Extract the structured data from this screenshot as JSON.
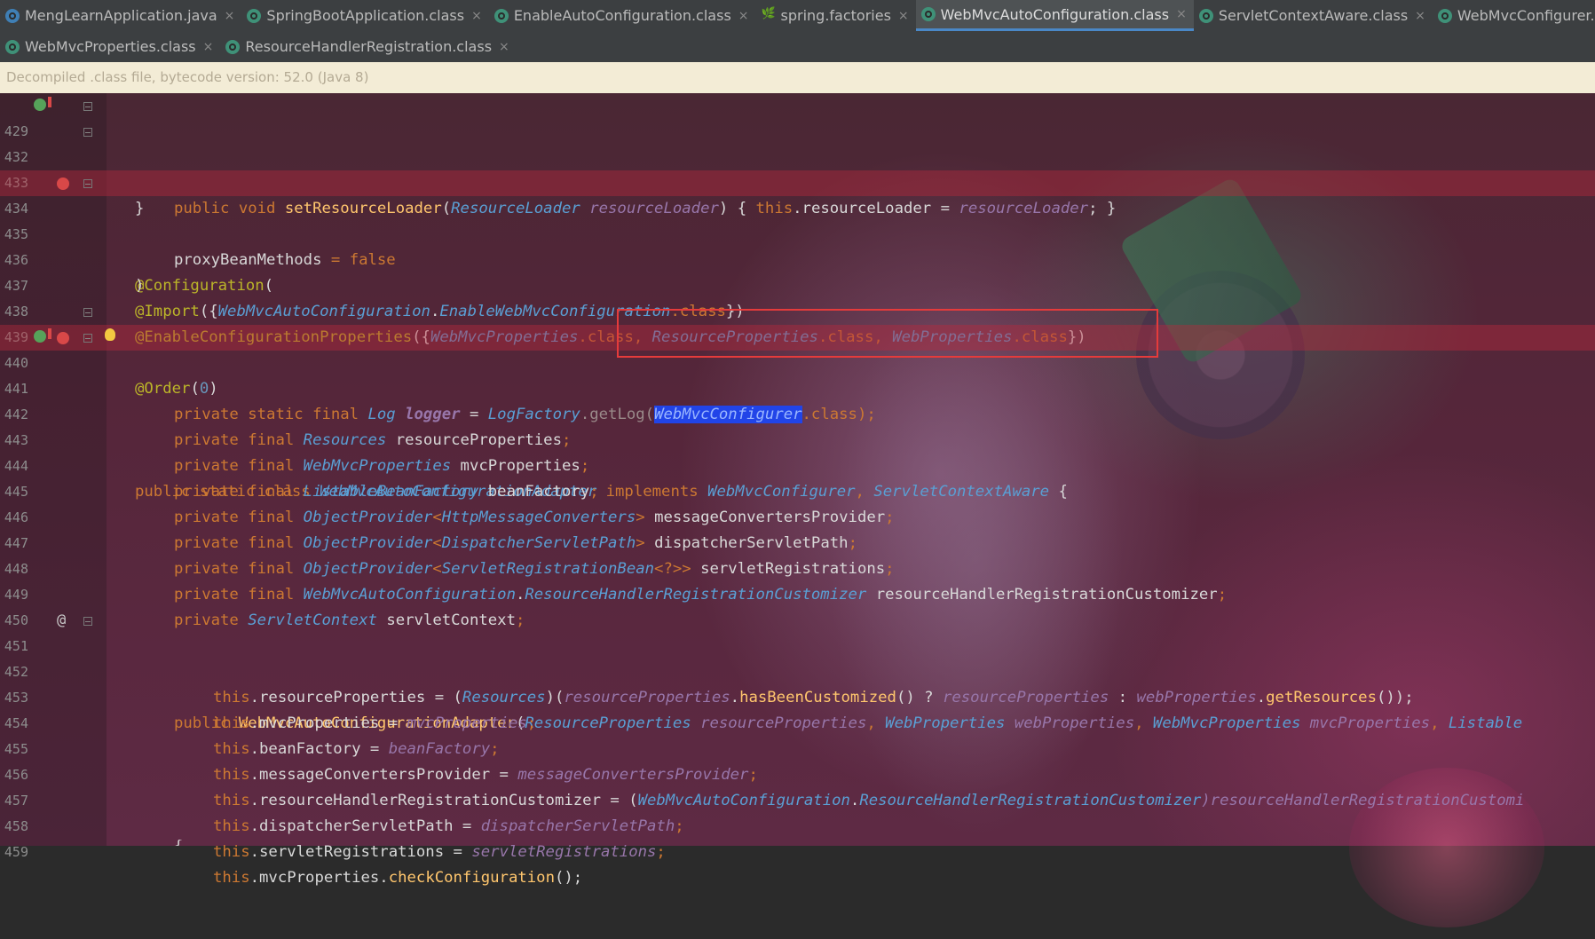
{
  "tabs_row1": [
    {
      "label": "MengLearnApplication.java",
      "icon": "java-class-icon",
      "active": false
    },
    {
      "label": "SpringBootApplication.class",
      "icon": "annotation-icon",
      "active": false
    },
    {
      "label": "EnableAutoConfiguration.class",
      "icon": "annotation-icon",
      "active": false
    },
    {
      "label": "spring.factories",
      "icon": "spring-leaf-icon",
      "active": false
    },
    {
      "label": "WebMvcAutoConfiguration.class",
      "icon": "class-icon",
      "active": true
    },
    {
      "label": "ServletContextAware.class",
      "icon": "interface-icon",
      "active": false
    },
    {
      "label": "WebMvcConfigurer.class",
      "icon": "interface-icon",
      "active": false
    }
  ],
  "tabs_row2": [
    {
      "label": "WebMvcProperties.class",
      "icon": "class-icon",
      "active": false
    },
    {
      "label": "ResourceHandlerRegistration.class",
      "icon": "class-icon",
      "active": false
    }
  ],
  "tab_close_glyph": "×",
  "notice": "Decompiled .class file, bytecode version: 52.0 (Java 8)",
  "gutter": {
    "at_symbol": "@",
    "line_numbers": [
      "429",
      "432",
      "433",
      "434",
      "435",
      "436",
      "437",
      "438",
      "439",
      "440",
      "441",
      "442",
      "443",
      "444",
      "445",
      "446",
      "447",
      "448",
      "449",
      "450",
      "451",
      "452",
      "453",
      "454",
      "455",
      "456",
      "457",
      "458",
      "459"
    ]
  },
  "code": {
    "l429": {
      "a": "public void ",
      "b": "setResourceLoader",
      "c": "(",
      "d": "ResourceLoader ",
      "e": "resourceLoader",
      "f": ") { ",
      "g": "this",
      "h": ".resourceLoader = ",
      "i": "resourceLoader",
      "j": "; }"
    },
    "l432": {
      "a": "}"
    },
    "l434": {
      "a": "@Configuration",
      "b": "("
    },
    "l435": {
      "a": "proxyBeanMethods ",
      "b": "= ",
      "c": "false"
    },
    "l436": {
      "a": ")"
    },
    "l437": {
      "a": "@Import",
      "b": "({",
      "c": "WebMvcAutoConfiguration",
      "d": ".",
      "e": "EnableWebMvcConfiguration",
      "f": ".class",
      "g": "})"
    },
    "l438": {
      "a": "@EnableConfigurationProperties",
      "b": "({",
      "c": "WebMvcProperties",
      "d": ".class, ",
      "e": "ResourceProperties",
      "f": ".class, ",
      "g": "WebProperties",
      "h": ".class",
      "i": "})"
    },
    "l439": {
      "a": "@Order",
      "b": "(",
      "c": "0",
      "d": ")"
    },
    "l440": {
      "a": "public static class ",
      "b": "WebMvcAutoConfigurationAdapter ",
      "c": "implements ",
      "d": "WebMvcConfigurer",
      "e": ", ",
      "f": "ServletContextAware ",
      "g": "{"
    },
    "l441": {
      "a": "private static final ",
      "b": "Log ",
      "c": "logger",
      "d": " = ",
      "e": "LogFactory",
      "f": ".getLog(",
      "g": "WebMvcConfigurer",
      "h": ".class);"
    },
    "l442": {
      "a": "private final ",
      "b": "Resources ",
      "c": "resourceProperties",
      "d": ";"
    },
    "l443": {
      "a": "private final ",
      "b": "WebMvcProperties ",
      "c": "mvcProperties",
      "d": ";"
    },
    "l444": {
      "a": "private final ",
      "b": "ListableBeanFactory ",
      "c": "beanFactory",
      "d": ";"
    },
    "l445": {
      "a": "private final ",
      "b": "ObjectProvider",
      "c": "<",
      "d": "HttpMessageConverters",
      "e": "> ",
      "f": "messageConvertersProvider",
      "g": ";"
    },
    "l446": {
      "a": "private final ",
      "b": "ObjectProvider",
      "c": "<",
      "d": "DispatcherServletPath",
      "e": "> ",
      "f": "dispatcherServletPath",
      "g": ";"
    },
    "l447": {
      "a": "private final ",
      "b": "ObjectProvider",
      "c": "<",
      "d": "ServletRegistrationBean",
      "e": "<?>> ",
      "f": "servletRegistrations",
      "g": ";"
    },
    "l448": {
      "a": "private final ",
      "b": "WebMvcAutoConfiguration",
      "c": ".",
      "d": "ResourceHandlerRegistrationCustomizer ",
      "e": "resourceHandlerRegistrationCustomizer",
      "f": ";"
    },
    "l449": {
      "a": "private ",
      "b": "ServletContext ",
      "c": "servletContext",
      "d": ";"
    },
    "l451": {
      "a": "public ",
      "b": "WebMvcAutoConfigurationAdapter",
      "c": "(",
      "d": "ResourceProperties ",
      "e": "resourceProperties",
      "f": ", ",
      "g": "WebProperties ",
      "h": "webProperties",
      "i": ", ",
      "j": "WebMvcProperties ",
      "k": "mvcProperties",
      "l": ", ",
      "m": "Listable"
    },
    "l452": {
      "a": "this",
      "b": ".resourceProperties = (",
      "c": "Resources",
      "d": ")(",
      "e": "resourceProperties",
      "f": ".",
      "g": "hasBeenCustomized",
      "h": "() ? ",
      "i": "resourceProperties",
      "j": " : ",
      "k": "webProperties",
      "l": ".",
      "m": "getResources",
      "n": "());"
    },
    "l453": {
      "a": "this",
      "b": ".mvcProperties = ",
      "c": "mvcProperties",
      "d": ";"
    },
    "l454": {
      "a": "this",
      "b": ".beanFactory = ",
      "c": "beanFactory",
      "d": ";"
    },
    "l455": {
      "a": "this",
      "b": ".messageConvertersProvider = ",
      "c": "messageConvertersProvider",
      "d": ";"
    },
    "l456": {
      "a": "this",
      "b": ".resourceHandlerRegistrationCustomizer = (",
      "c": "WebMvcAutoConfiguration",
      "d": ".",
      "e": "ResourceHandlerRegistrationCustomizer",
      "f": ")resourceHandlerRegistrationCustomi"
    },
    "l457": {
      "a": "this",
      "b": ".dispatcherServletPath = ",
      "c": "dispatcherServletPath",
      "d": ";"
    },
    "l458": {
      "a": "this",
      "b": ".servletRegistrations = ",
      "c": "servletRegistrations",
      "d": ";"
    },
    "l459": {
      "a": "this",
      "b": ".mvcProperties.",
      "c": "checkConfiguration",
      "d": "();"
    },
    "l460": {
      "a": "}"
    }
  },
  "colors": {
    "keyword": "#cc7832",
    "annotation": "#bbb529",
    "type": "#5a9fd4",
    "method": "#ffc66d",
    "field": "#9876aa",
    "breakpoint": "#d94848",
    "highlight_box": "#e53b3b",
    "active_tab_underline": "#4a88c7"
  }
}
